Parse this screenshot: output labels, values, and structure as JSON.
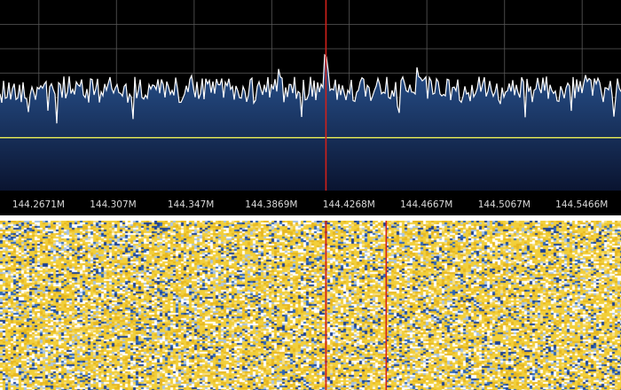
{
  "app": {
    "view": "spectrum-waterfall"
  },
  "colors": {
    "background": "#000000",
    "grid": "#5a5a5a",
    "trace": "#ffffff",
    "fill_top": "#2a5694",
    "fill_bottom": "#0a1430",
    "squelch_line": "#ffff55",
    "cursor": "#d0201a",
    "waterfall_palette": [
      "#f2cf3a",
      "#e8b820",
      "#ffffff",
      "#1b3f93",
      "#2d66b8",
      "#a8c4e6",
      "#f6e08a"
    ]
  },
  "spectrum": {
    "freq_start_mhz": 144.2471,
    "freq_end_mhz": 144.5666,
    "cursor_freq_mhz": 144.4148,
    "secondary_marker_freq_mhz": 144.4458,
    "noise_floor_level": 0.53,
    "squelch_level": 0.24,
    "peak_level": 0.66,
    "tick_labels": [
      {
        "freq": 144.2671,
        "label": "144.2671M"
      },
      {
        "freq": 144.307,
        "label": "144.307M"
      },
      {
        "freq": 144.347,
        "label": "144.347M"
      },
      {
        "freq": 144.3869,
        "label": "144.3869M"
      },
      {
        "freq": 144.4268,
        "label": "144.4268M"
      },
      {
        "freq": 144.4667,
        "label": "144.4667M"
      },
      {
        "freq": 144.5067,
        "label": "144.5067M"
      },
      {
        "freq": 144.5466,
        "label": "144.5466M"
      }
    ]
  }
}
